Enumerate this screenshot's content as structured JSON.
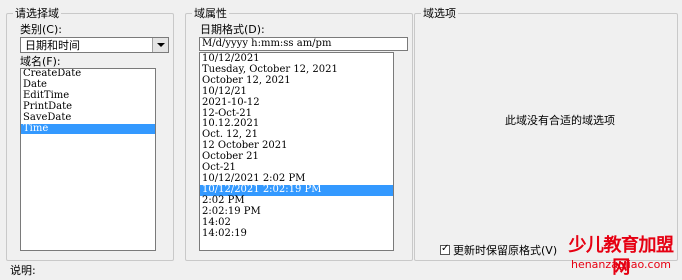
{
  "choose_field": {
    "group_title": "请选择域",
    "category_label": "类别(C):",
    "category_value": "日期和时间",
    "field_names_label": "域名(F):",
    "field_names": [
      "CreateDate",
      "Date",
      "EditTime",
      "PrintDate",
      "SaveDate",
      "Time"
    ],
    "selected_field": "Time"
  },
  "field_properties": {
    "group_title": "域属性",
    "date_format_label": "日期格式(D):",
    "date_format_value": "M/d/yyyy h:mm:ss am/pm",
    "formats": [
      "10/12/2021",
      "Tuesday, October 12, 2021",
      "October 12, 2021",
      "10/12/21",
      "2021-10-12",
      "12-Oct-21",
      "10.12.2021",
      "Oct. 12, 21",
      "12 October 2021",
      "October 21",
      "Oct-21",
      "10/12/2021 2:02 PM",
      "10/12/2021 2:02:19 PM",
      "2:02 PM",
      "2:02:19 PM",
      "14:02",
      "14:02:19"
    ],
    "selected_format_index": 12
  },
  "field_options": {
    "group_title": "域选项",
    "empty_message": "此域没有合适的域选项",
    "preserve_formatting_label": "更新时保留原格式(V)",
    "preserve_formatting_checked": true
  },
  "description": {
    "label": "说明:"
  },
  "watermark": {
    "title": "少儿教育加盟网",
    "url": "henanzaojiao.com"
  }
}
